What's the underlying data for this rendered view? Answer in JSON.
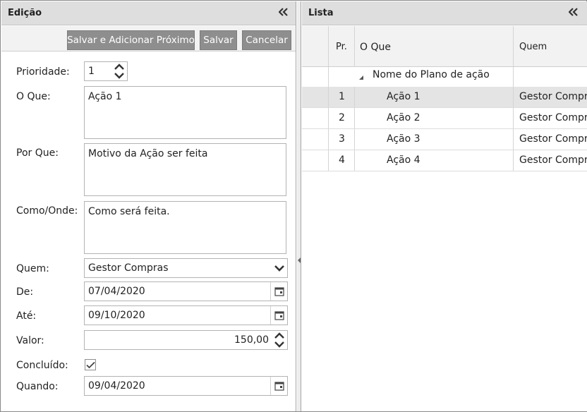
{
  "edit_panel": {
    "title": "Edição",
    "toolbar": {
      "save_add_next": "Salvar e Adicionar Próximo",
      "save": "Salvar",
      "cancel": "Cancelar"
    },
    "fields": {
      "priority": {
        "label": "Prioridade:",
        "value": "1"
      },
      "what": {
        "label": "O Que:",
        "value": "Ação 1"
      },
      "why": {
        "label": "Por Que:",
        "value": "Motivo da Ação ser feita"
      },
      "how_where": {
        "label": "Como/Onde:",
        "value": "Como será feita."
      },
      "who": {
        "label": "Quem:",
        "value": "Gestor Compras"
      },
      "from": {
        "label": "De:",
        "value": "07/04/2020"
      },
      "until": {
        "label": "Até:",
        "value": "09/10/2020"
      },
      "amount": {
        "label": "Valor:",
        "value": "150,00"
      },
      "done": {
        "label": "Concluído:",
        "checked": true
      },
      "when": {
        "label": "Quando:",
        "value": "09/04/2020"
      }
    }
  },
  "list_panel": {
    "title": "Lista",
    "columns": [
      "Pr.",
      "O Que",
      "Quem"
    ],
    "group": "Nome do Plano de ação",
    "rows": [
      {
        "pr": "1",
        "what": "Ação 1",
        "who": "Gestor Compras",
        "selected": true
      },
      {
        "pr": "2",
        "what": "Ação 2",
        "who": "Gestor Compras",
        "selected": false
      },
      {
        "pr": "3",
        "what": "Ação 3",
        "who": "Gestor Compras",
        "selected": false
      },
      {
        "pr": "4",
        "what": "Ação 4",
        "who": "Gestor Compras",
        "selected": false
      }
    ]
  },
  "icons": {
    "collapse": "double-chevron-left-icon",
    "spinner": "up-down-arrows-icon",
    "dropdown": "chevron-down-icon",
    "calendar": "calendar-icon",
    "expand": "triangle-expand-icon",
    "check": "checkmark-icon"
  },
  "colors": {
    "button_bg": "#8e8e8e",
    "header_bg": "#dedede",
    "selected_row": "#e4e4e4"
  }
}
